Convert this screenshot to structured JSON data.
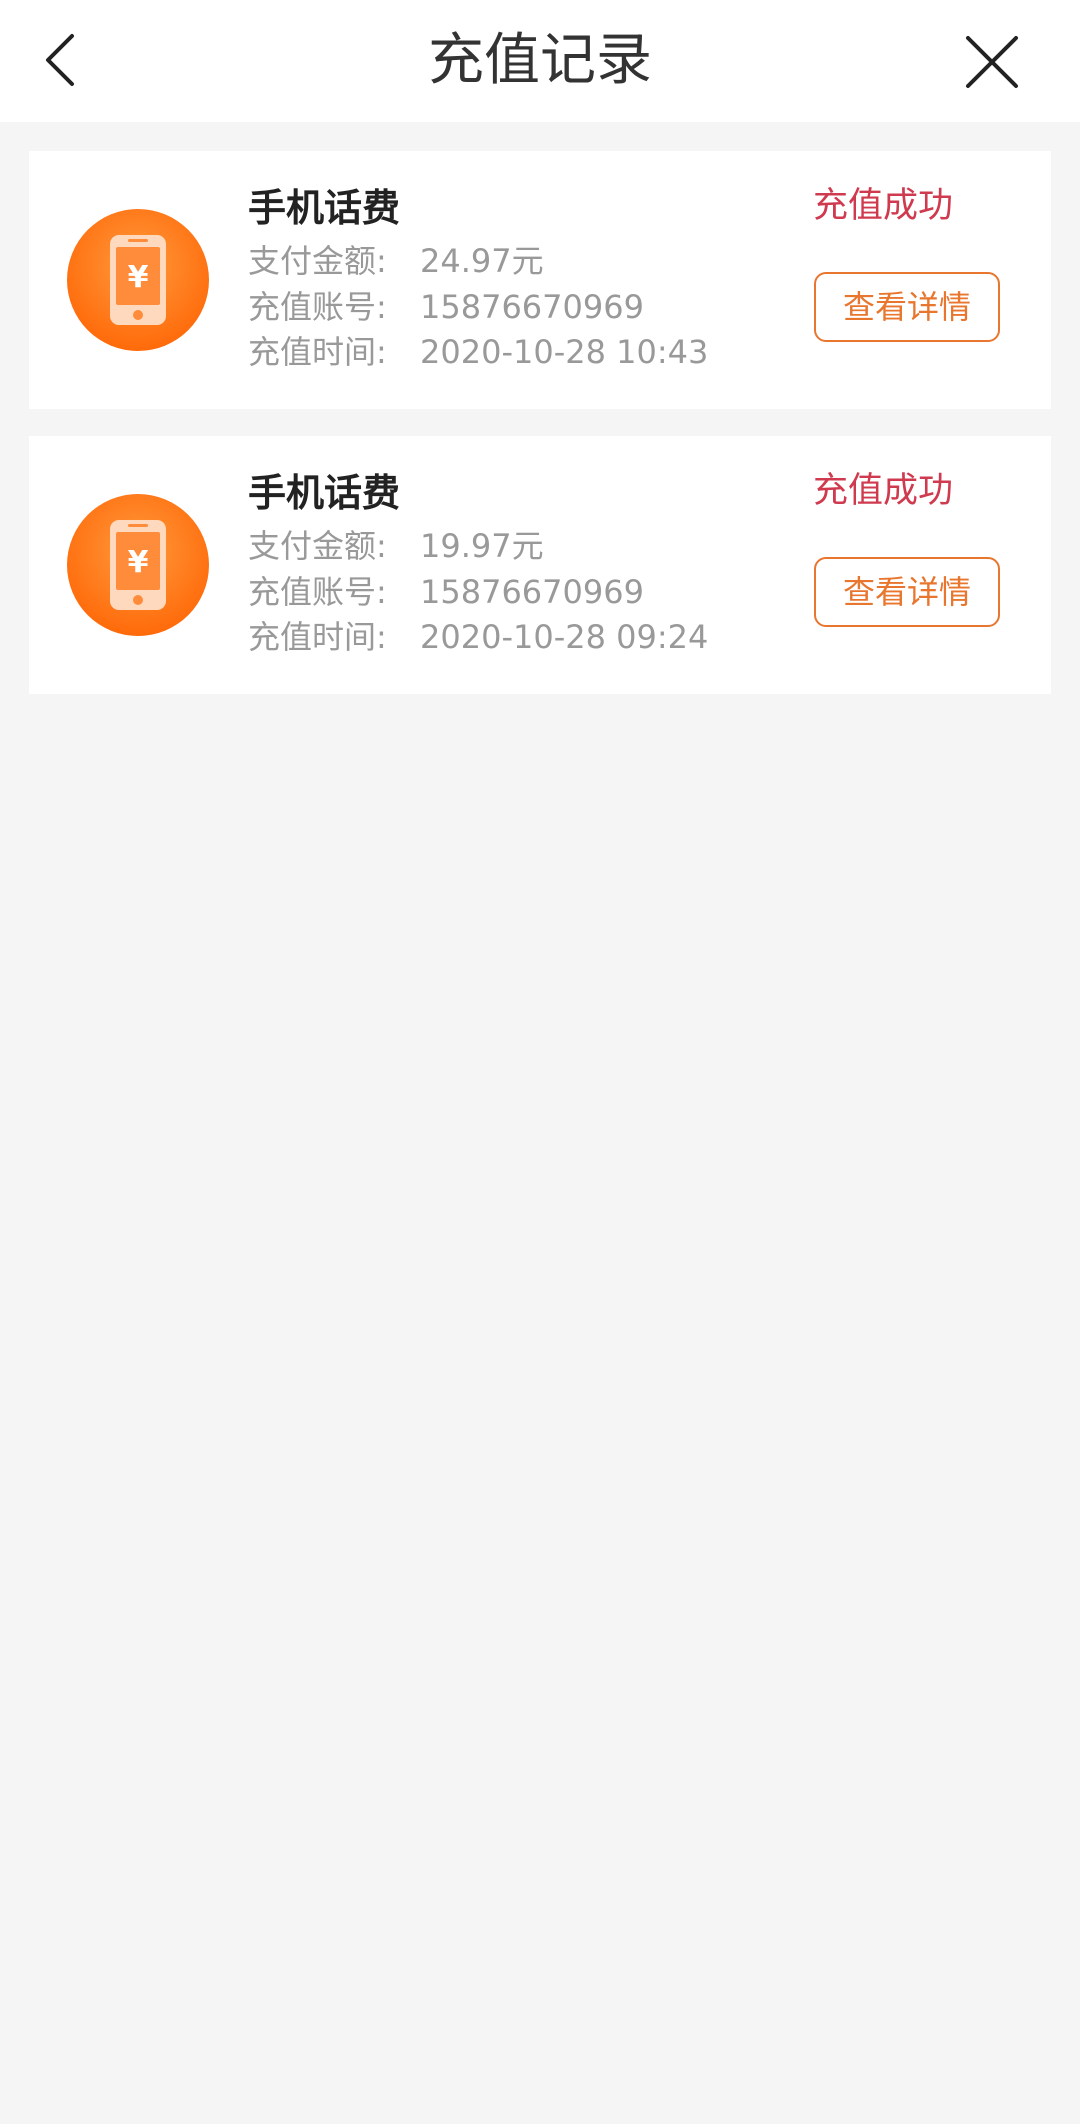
{
  "header": {
    "title": "充值记录",
    "back_icon": "chevron-left-icon",
    "close_icon": "close-icon"
  },
  "records": [
    {
      "icon": "phone-yuan-icon",
      "title": "手机话费",
      "status": "充值成功",
      "amount_label": "支付金额:",
      "amount": "24.97元",
      "account_label": "充值账号:",
      "account": "15876670969",
      "time_label": "充值时间:",
      "time": "2020-10-28  10:43",
      "detail_label": "查看详情"
    },
    {
      "icon": "phone-yuan-icon",
      "title": "手机话费",
      "status": "充值成功",
      "amount_label": "支付金额:",
      "amount": "19.97元",
      "account_label": "充值账号:",
      "account": "15876670969",
      "time_label": "充值时间:",
      "time": "2020-10-28  09:24",
      "detail_label": "查看详情"
    }
  ],
  "colors": {
    "accent_orange": "#e8762e",
    "status_red": "#cf3a4f",
    "background": "#f5f5f5",
    "icon_orange": "#ff7a1a"
  }
}
